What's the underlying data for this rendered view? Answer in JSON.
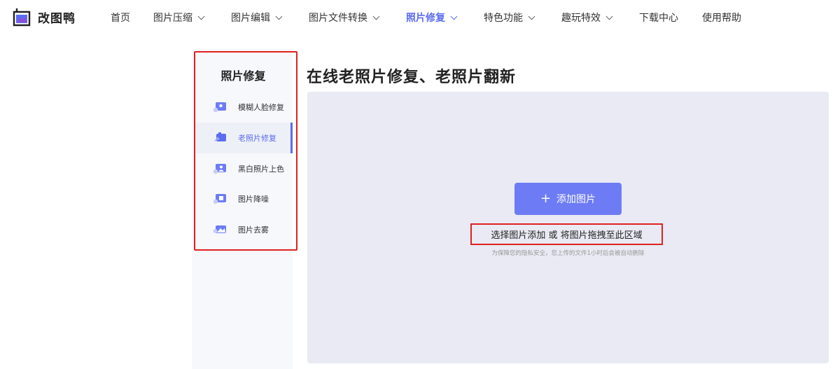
{
  "header": {
    "logo_text": "改图鸭",
    "nav": [
      {
        "label": "首页",
        "has_dropdown": false,
        "active": false
      },
      {
        "label": "图片压缩",
        "has_dropdown": true,
        "active": false
      },
      {
        "label": "图片编辑",
        "has_dropdown": true,
        "active": false
      },
      {
        "label": "图片文件转换",
        "has_dropdown": true,
        "active": false
      },
      {
        "label": "照片修复",
        "has_dropdown": true,
        "active": true
      },
      {
        "label": "特色功能",
        "has_dropdown": true,
        "active": false
      },
      {
        "label": "趣玩特效",
        "has_dropdown": true,
        "active": false
      },
      {
        "label": "下载中心",
        "has_dropdown": false,
        "active": false
      },
      {
        "label": "使用帮助",
        "has_dropdown": false,
        "active": false
      }
    ]
  },
  "sidebar": {
    "title": "照片修复",
    "items": [
      {
        "label": "模糊人脸修复",
        "icon": "blurry-face-icon",
        "active": false
      },
      {
        "label": "老照片修复",
        "icon": "old-photo-icon",
        "active": true
      },
      {
        "label": "黑白照片上色",
        "icon": "colorize-icon",
        "active": false
      },
      {
        "label": "图片降噪",
        "icon": "denoise-icon",
        "active": false
      },
      {
        "label": "图片去雾",
        "icon": "dehaze-icon",
        "active": false
      }
    ]
  },
  "main": {
    "title": "在线老照片修复、老照片翻新",
    "add_button_plus": "+",
    "add_button_label": "添加图片",
    "hint": "选择图片添加 或 将图片拖拽至此区域",
    "privacy_note": "为保障您的隐私安全，您上传的文件1小时后会被自动删除"
  },
  "colors": {
    "accent": "#5b6cf0",
    "button": "#6d7cf5",
    "upload_bg": "#e9eaf3",
    "highlight_border": "#e02020"
  }
}
